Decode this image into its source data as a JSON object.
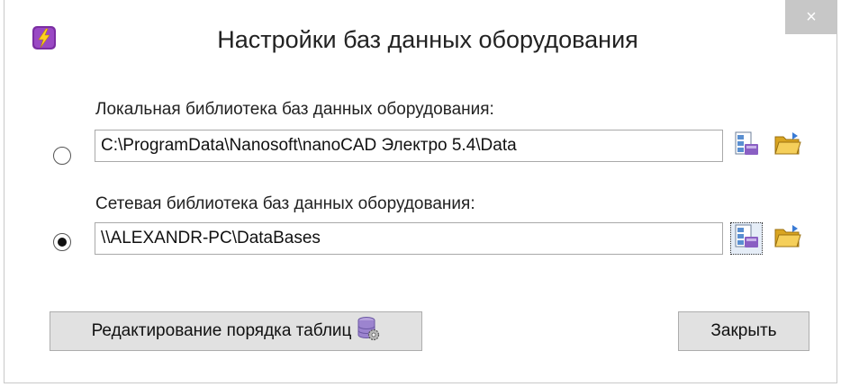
{
  "window": {
    "title": "Настройки баз данных оборудования",
    "close_glyph": "×"
  },
  "local": {
    "label": "Локальная библиотека баз данных оборудования:",
    "path": "C:\\ProgramData\\Nanosoft\\nanoCAD Электро 5.4\\Data",
    "selected": false
  },
  "network": {
    "label": "Сетевая библиотека баз данных оборудования:",
    "path": "\\\\ALEXANDR-PC\\DataBases",
    "selected": true
  },
  "buttons": {
    "edit_order_label": "Редактирование порядка таблиц",
    "close_label": "Закрыть"
  },
  "icons": {
    "app": "lightning-icon",
    "database_settings": "database-settings-icon",
    "open_folder": "open-folder-icon",
    "database_gear": "database-gear-icon"
  },
  "colors": {
    "app_icon_bg": "#7b2ea3",
    "app_icon_bolt": "#ffd21f",
    "close_bg": "#c7c7c7",
    "button_bg": "#e1e1e1",
    "folder": "#f2c23b"
  }
}
